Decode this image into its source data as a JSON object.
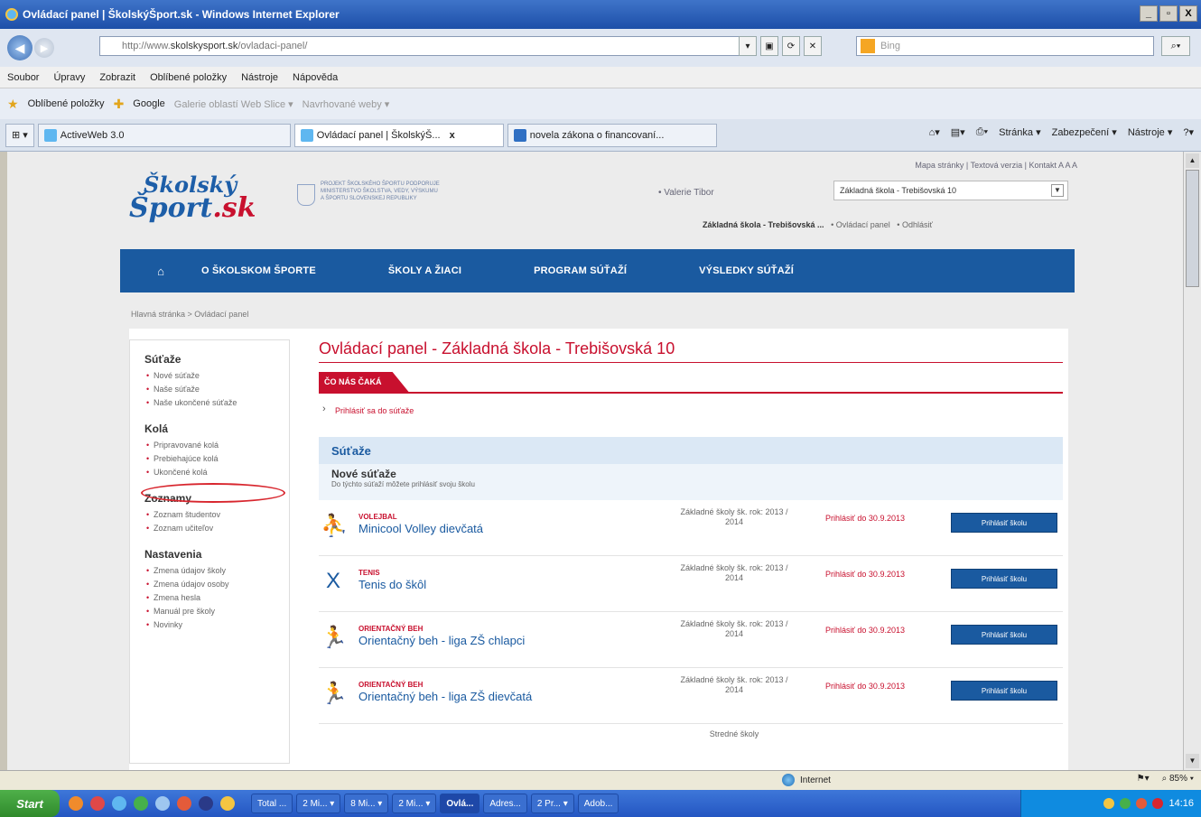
{
  "window": {
    "title": "Ovládací panel | ŠkolskýŠport.sk - Windows Internet Explorer",
    "min": "_",
    "max": "▫",
    "close": "X"
  },
  "address": {
    "url_prefix": "http://www.",
    "url_domain": "skolskysport.sk",
    "url_path": "/ovladaci-panel/",
    "search_placeholder": "Bing"
  },
  "menu": [
    "Soubor",
    "Úpravy",
    "Zobrazit",
    "Oblíbené položky",
    "Nástroje",
    "Nápověda"
  ],
  "favorites": {
    "label": "Oblíbené položky",
    "items": [
      "Google",
      "Galerie oblastí Web Slice ▾",
      "Navrhované weby ▾"
    ]
  },
  "tabs": [
    {
      "label": "ActiveWeb 3.0",
      "active": false
    },
    {
      "label": "Ovládací panel | ŠkolskýŠ...",
      "active": true
    },
    {
      "label": "novela zákona o financovaní...",
      "active": false
    }
  ],
  "commandbar": [
    "Stránka ▾",
    "Zabezpečení ▾",
    "Nástroje ▾",
    "?▾"
  ],
  "site": {
    "logo_line1": "Školský",
    "logo_line2_a": "Šport",
    "logo_line2_b": ".sk",
    "ministry": "PROJEKT ŠKOLSKÉHO ŠPORTU PODPORUJE MINISTERSTVO ŠKOLSTVA, VEDY, VÝSKUMU A ŠPORTU SLOVENSKEJ REPUBLIKY",
    "toplinks": "Mapa stránky | Textová verzia | Kontakt   A A A",
    "user": "• Valerie Tibor",
    "school_select": "Základná škola - Trebišovská 10",
    "school_name": "Základná škola - Trebišovská ...",
    "link_panel": "• Ovládací panel",
    "link_logout": "• Odhlásiť",
    "nav": [
      "O ŠKOLSKOM ŠPORTE",
      "ŠKOLY A ŽIACI",
      "PROGRAM SÚŤAŽÍ",
      "VÝSLEDKY SÚŤAŽÍ"
    ],
    "breadcrumb": "Hlavná stránka  >  Ovládací panel"
  },
  "sidebar": {
    "sections": [
      {
        "title": "Súťaže",
        "items": [
          "Nové súťaže",
          "Naše súťaže",
          "Naše ukončené súťaže"
        ]
      },
      {
        "title": "Kolá",
        "items": [
          "Pripravované kolá",
          "Prebiehajúce kolá",
          "Ukončené kolá"
        ]
      },
      {
        "title": "Zoznamy",
        "items": [
          "Zoznam študentov",
          "Zoznam učiteľov"
        ]
      },
      {
        "title": "Nastavenia",
        "items": [
          "Zmena údajov školy",
          "Zmena údajov osoby",
          "Zmena hesla",
          "Manuál pre školy",
          "Novinky"
        ]
      }
    ]
  },
  "main": {
    "title": "Ovládací panel - Základná škola - Trebišovská 10",
    "ribbon": "ČO NÁS ČAKÁ",
    "join_link": "Prihlásiť sa do súťaže",
    "comp_header": "Súťaže",
    "comp_sub_title": "Nové súťaže",
    "comp_sub_desc": "Do týchto súťaží môžete prihlásiť svoju školu",
    "rows": [
      {
        "sport": "VOLEJBAL",
        "name": "Minicool Volley dievčatá",
        "cat": "Základné školy šk. rok: 2013 / 2014",
        "dl": "Prihlásiť do 30.9.2013",
        "btn": "Prihlásiť školu"
      },
      {
        "sport": "TENIS",
        "name": "Tenis do škôl",
        "cat": "Základné školy šk. rok: 2013 / 2014",
        "dl": "Prihlásiť do 30.9.2013",
        "btn": "Prihlásiť školu"
      },
      {
        "sport": "ORIENTAČNÝ BEH",
        "name": "Orientačný beh - liga ZŠ chlapci",
        "cat": "Základné školy šk. rok: 2013 / 2014",
        "dl": "Prihlásiť do 30.9.2013",
        "btn": "Prihlásiť školu"
      },
      {
        "sport": "ORIENTAČNÝ BEH",
        "name": "Orientačný beh - liga ZŠ dievčatá",
        "cat": "Základné školy šk. rok: 2013 / 2014",
        "dl": "Prihlásiť do 30.9.2013",
        "btn": "Prihlásiť školu"
      }
    ],
    "partial_row_cat": "Stredné školy"
  },
  "status": {
    "zone": "Internet",
    "zoom": "85%"
  },
  "taskbar": {
    "start": "Start",
    "tasks": [
      "Total ...",
      "2 Mi... ▾",
      "8 Mi... ▾",
      "2 Mi... ▾",
      "Ovlá...",
      "Adres...",
      "2 Pr... ▾",
      "Adob..."
    ],
    "time": "14:16"
  }
}
